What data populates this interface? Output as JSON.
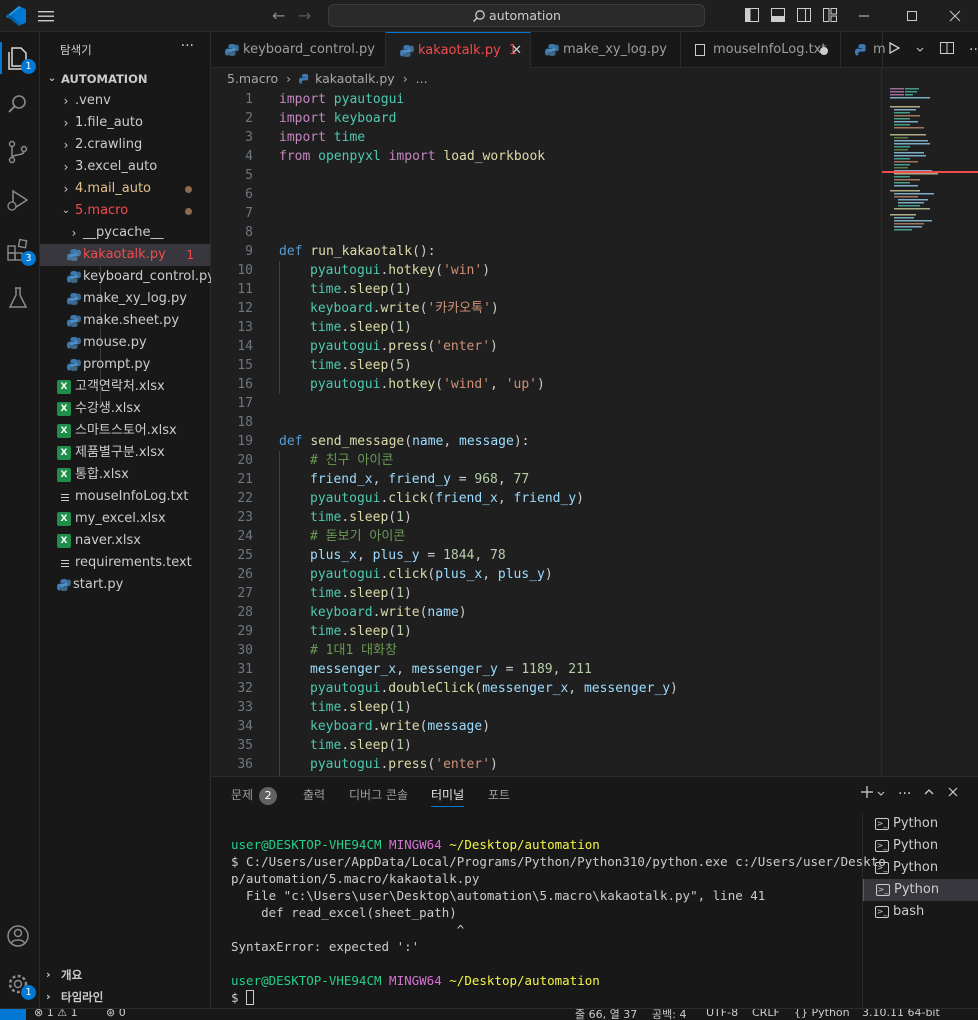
{
  "titlebar": {
    "search_text": "automation"
  },
  "activity": {
    "explorer_badge": "1",
    "extensions_badge": "3",
    "settings_badge": "1"
  },
  "sidebar": {
    "title": "탐색기",
    "more": "···",
    "root": "AUTOMATION",
    "items": [
      {
        "label": ".venv",
        "kind": "folder"
      },
      {
        "label": "1.file_auto",
        "kind": "folder"
      },
      {
        "label": "2.crawling",
        "kind": "folder"
      },
      {
        "label": "3.excel_auto",
        "kind": "folder"
      },
      {
        "label": "4.mail_auto",
        "kind": "folder",
        "status": "modified"
      },
      {
        "label": "5.macro",
        "kind": "folder-open",
        "status": "modified"
      },
      {
        "label": "__pycache__",
        "kind": "subfolder"
      },
      {
        "label": "kakaotalk.py",
        "kind": "py",
        "errors": "1"
      },
      {
        "label": "keyboard_control.py",
        "kind": "py"
      },
      {
        "label": "make_xy_log.py",
        "kind": "py"
      },
      {
        "label": "make.sheet.py",
        "kind": "py"
      },
      {
        "label": "mouse.py",
        "kind": "py"
      },
      {
        "label": "prompt.py",
        "kind": "py"
      },
      {
        "label": "고객연락처.xlsx",
        "kind": "xlsx"
      },
      {
        "label": "수강생.xlsx",
        "kind": "xlsx"
      },
      {
        "label": "스마트스토어.xlsx",
        "kind": "xlsx"
      },
      {
        "label": "제품별구분.xlsx",
        "kind": "xlsx"
      },
      {
        "label": "통합.xlsx",
        "kind": "xlsx"
      },
      {
        "label": "mouseInfoLog.txt",
        "kind": "txt"
      },
      {
        "label": "my_excel.xlsx",
        "kind": "xlsx"
      },
      {
        "label": "naver.xlsx",
        "kind": "xlsx"
      },
      {
        "label": "requirements.text",
        "kind": "txt"
      },
      {
        "label": "start.py",
        "kind": "py"
      }
    ],
    "outline": "개요",
    "timeline": "타임라인"
  },
  "tabs": [
    {
      "label": "keyboard_control.py"
    },
    {
      "label": "kakaotalk.py",
      "errors": "1"
    },
    {
      "label": "make_xy_log.py"
    },
    {
      "label": "mouseInfoLog.txt"
    },
    {
      "label": "m"
    }
  ],
  "breadcrumb": {
    "folder": "5.macro",
    "file": "kakaotalk.py",
    "more": "..."
  },
  "code": [
    "1",
    "2",
    "3",
    "4",
    "5",
    "6",
    "7",
    "8",
    "9",
    "10",
    "11",
    "12",
    "13",
    "14",
    "15",
    "16",
    "17",
    "18",
    "19",
    "20",
    "21",
    "22",
    "23",
    "24",
    "25",
    "26",
    "27",
    "28",
    "29",
    "30",
    "31",
    "32",
    "33",
    "34",
    "35",
    "36"
  ],
  "code_text": {
    "l1": [
      "import",
      " pyautogui"
    ],
    "l2": [
      "import",
      " keyboard"
    ],
    "l3": [
      "import",
      " time"
    ],
    "l4": [
      "from",
      " openpyxl ",
      "import",
      " load_workbook"
    ],
    "l9": [
      "def",
      " ",
      "run_kakaotalk",
      "():"
    ],
    "l10": [
      "pyautogui",
      ".",
      "hotkey",
      "(",
      "'win'",
      ")"
    ],
    "l11": [
      "time",
      ".",
      "sleep",
      "(",
      "1",
      ")"
    ],
    "l12": [
      "keyboard",
      ".",
      "write",
      "(",
      "'카카오톡'",
      ")"
    ],
    "l13": [
      "time",
      ".",
      "sleep",
      "(",
      "1",
      ")"
    ],
    "l14": [
      "pyautogui",
      ".",
      "press",
      "(",
      "'enter'",
      ")"
    ],
    "l15": [
      "time",
      ".",
      "sleep",
      "(",
      "5",
      ")"
    ],
    "l16": [
      "pyautogui",
      ".",
      "hotkey",
      "(",
      "'wind'",
      ", ",
      "'up'",
      ")"
    ],
    "l19": [
      "def",
      " ",
      "send_message",
      "(",
      "name",
      ", ",
      "message",
      "):"
    ],
    "l20": [
      "# 친구 아이콘"
    ],
    "l21": [
      "friend_x",
      ", ",
      "friend_y",
      " = ",
      "968",
      ", ",
      "77"
    ],
    "l22": [
      "pyautogui",
      ".",
      "click",
      "(",
      "friend_x",
      ", ",
      "friend_y",
      ")"
    ],
    "l23": [
      "time",
      ".",
      "sleep",
      "(",
      "1",
      ")"
    ],
    "l24": [
      "# 돋보기 아이콘"
    ],
    "l25": [
      "plus_x",
      ", ",
      "plus_y",
      " = ",
      "1844",
      ", ",
      "78"
    ],
    "l26": [
      "pyautogui",
      ".",
      "click",
      "(",
      "plus_x",
      ", ",
      "plus_y",
      ")"
    ],
    "l27": [
      "time",
      ".",
      "sleep",
      "(",
      "1",
      ")"
    ],
    "l28": [
      "keyboard",
      ".",
      "write",
      "(",
      "name",
      ")"
    ],
    "l29": [
      "time",
      ".",
      "sleep",
      "(",
      "1",
      ")"
    ],
    "l30": [
      "# 1대1 대화창"
    ],
    "l31": [
      "messenger_x",
      ", ",
      "messenger_y",
      " = ",
      "1189",
      ", ",
      "211"
    ],
    "l32": [
      "pyautogui",
      ".",
      "doubleClick",
      "(",
      "messenger_x",
      ", ",
      "messenger_y",
      ")"
    ],
    "l33": [
      "time",
      ".",
      "sleep",
      "(",
      "1",
      ")"
    ],
    "l34": [
      "keyboard",
      ".",
      "write",
      "(",
      "message",
      ")"
    ],
    "l35": [
      "time",
      ".",
      "sleep",
      "(",
      "1",
      ")"
    ],
    "l36": [
      "pyautogui",
      ".",
      "press",
      "(",
      "'enter'",
      ")"
    ]
  },
  "panel": {
    "tabs": [
      "문제",
      "출력",
      "디버그 콘솔",
      "터미널",
      "포트"
    ],
    "problems_count": "2",
    "terminal": {
      "prompt_user": "user@DESKTOP-VHE94CM",
      "prompt_shell": "MINGW64",
      "prompt_path": "~/Desktop/automation",
      "cmd_line1": "$ C:/Users/user/AppData/Local/Programs/Python/Python310/python.exe c:/Users/user/Deskto",
      "cmd_line2": "p/automation/5.macro/kakaotalk.py",
      "err1": "  File \"c:\\Users\\user\\Desktop\\automation\\5.macro\\kakaotalk.py\", line 41",
      "err2": "    def read_excel(sheet_path)",
      "err3": "                              ^",
      "err4": "SyntaxError: expected ':'",
      "prompt_user2": "user@DESKTOP-VHE94CM",
      "prompt_shell2": "MINGW64",
      "prompt_path2": "~/Desktop/automation",
      "dollar": "$ "
    },
    "terminal_list": [
      "Python",
      "Python",
      "Python",
      "Python",
      "bash"
    ]
  },
  "statusbar": {
    "errors": "1",
    "warnings": "1",
    "ports": "0",
    "position": "줄 66, 열 37",
    "spaces": "공백: 4",
    "encoding": "UTF-8",
    "eol": "CRLF",
    "language": "Python",
    "interpreter": "3.10.11 64-bit"
  },
  "colors": {
    "accent": "#0078d4",
    "error": "#f14c4c",
    "modified": "#8c6b50",
    "editor_bg": "#1f1f1f",
    "sidebar_bg": "#181818"
  }
}
